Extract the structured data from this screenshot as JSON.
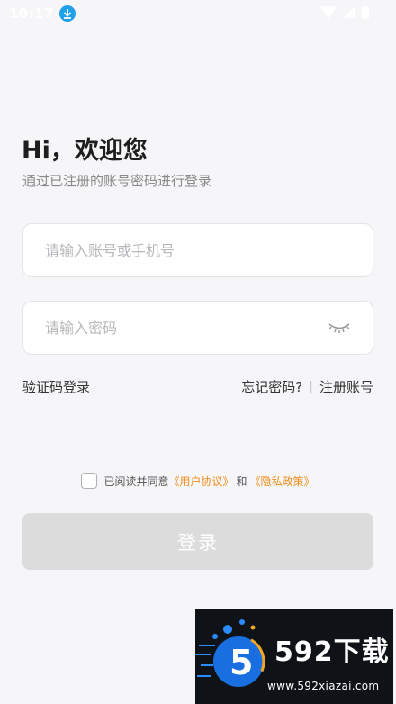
{
  "status_bar": {
    "time": "10:17",
    "icons": [
      "download-icon",
      "wifi-icon",
      "signal-icon",
      "battery-icon"
    ]
  },
  "header": {
    "greeting": "Hi，欢迎您",
    "subtitle": "通过已注册的账号密码进行登录"
  },
  "form": {
    "account_placeholder": "请输入账号或手机号",
    "account_value": "",
    "password_placeholder": "请输入密码",
    "password_value": "",
    "password_toggle_icon": "eye-closed-icon"
  },
  "links": {
    "sms_login": "验证码登录",
    "forgot_password": "忘记密码?",
    "divider": "|",
    "register": "注册账号"
  },
  "agreement": {
    "checked": false,
    "prefix": "已阅读并同意",
    "user_agreement": "《用户协议》",
    "conjunction": "和",
    "privacy_policy": "《隐私政策》"
  },
  "login_button": {
    "label": "登录"
  },
  "watermark": {
    "brand": "592下载",
    "url": "www.592xiazai.com",
    "logo_glyph": "5"
  },
  "colors": {
    "background": "#f6f6f8",
    "accent_link": "#f28c1a",
    "button_disabled": "#dcdcdc",
    "download_badge": "#1fa0e8"
  }
}
